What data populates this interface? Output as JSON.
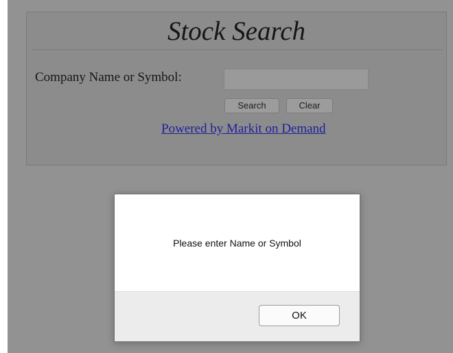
{
  "search_form": {
    "title": "Stock Search",
    "field_label": "Company Name or Symbol:",
    "input_value": "",
    "search_button": "Search",
    "clear_button": "Clear",
    "powered_link": "Powered by Markit on Demand"
  },
  "alert": {
    "message": "Please enter Name or Symbol",
    "ok_button": "OK"
  },
  "colors": {
    "overlay_background": "#929292",
    "link": "#1f1f9c",
    "dialog_background": "#ffffff",
    "dialog_footer": "#ececec"
  }
}
